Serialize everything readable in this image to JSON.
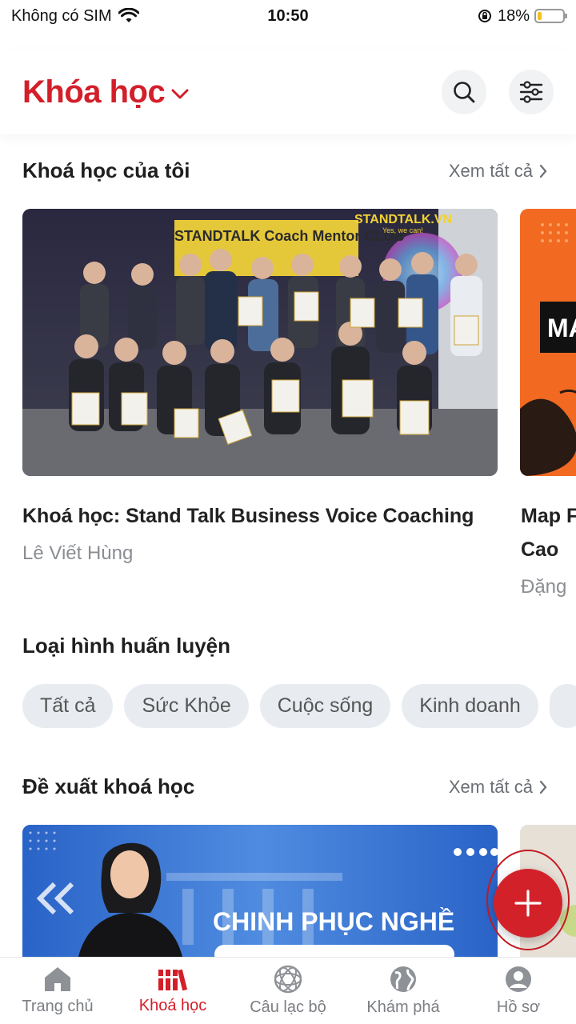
{
  "status": {
    "carrier": "Không có SIM",
    "time": "10:50",
    "battery": "18%",
    "battery_level": 0.18
  },
  "header": {
    "title": "Khóa học",
    "icons": [
      "chevron-down-icon",
      "search-icon",
      "filter-icon"
    ]
  },
  "my_courses": {
    "title": "Khoá học của tôi",
    "see_all": "Xem tất cả",
    "items": [
      {
        "title": "Khoá học: Stand Talk Business Voice Coaching",
        "author": "Lê Viết Hùng",
        "image_text": "STANDTALK.VN",
        "image_subtext": "Yes, we can!",
        "image_banner": "STANDTALK Coach Mentor CLUB"
      },
      {
        "title_line1": "Map F",
        "title_line2": "Cao",
        "author": "Đặng",
        "image_text": "MA"
      }
    ]
  },
  "training_types": {
    "title": "Loại hình huấn luyện",
    "chips": [
      "Tất cả",
      "Sức Khỏe",
      "Cuộc sống",
      "Kinh doanh"
    ]
  },
  "suggested": {
    "title": "Đề xuất khoá học",
    "see_all": "Xem tất cả",
    "banner_text": "CHINH PHỤC NGHỀ"
  },
  "colors": {
    "brand_red": "#d21f2a",
    "chip_bg": "#e8ecf1",
    "banner_blue": "#2f6fd3",
    "card_orange": "#f26a21"
  },
  "bottom_nav": [
    {
      "label": "Trang chủ",
      "icon": "home-icon"
    },
    {
      "label": "Khoá học",
      "icon": "courses-icon",
      "active": true
    },
    {
      "label": "Câu lạc bộ",
      "icon": "club-icon"
    },
    {
      "label": "Khám phá",
      "icon": "globe-icon"
    },
    {
      "label": "Hồ sơ",
      "icon": "profile-icon"
    }
  ]
}
